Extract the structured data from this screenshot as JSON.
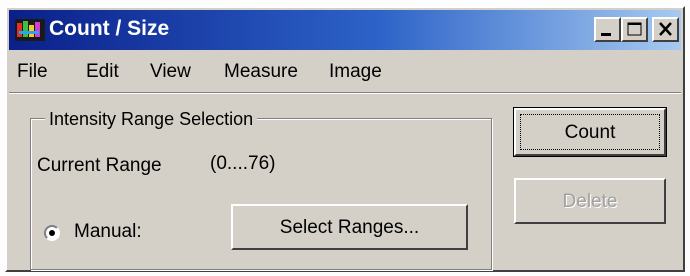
{
  "window": {
    "title": "Count / Size",
    "app_icon": "multicolor-app-icon",
    "controls": {
      "minimize_icon": "minimize-icon",
      "maximize_icon": "maximize-icon",
      "close_icon": "close-icon"
    },
    "colors": {
      "titlebar_start": "#0a1f8a",
      "titlebar_end": "#a6caf0",
      "face": "#d4d0c8"
    }
  },
  "menu": {
    "items": [
      {
        "label": "File"
      },
      {
        "label": "Edit"
      },
      {
        "label": "View"
      },
      {
        "label": "Measure"
      },
      {
        "label": "Image"
      }
    ]
  },
  "intensity": {
    "group_title": "Intensity Range Selection",
    "current_range_label": "Current Range",
    "current_range_value": "(0....76)",
    "manual_label": "Manual:",
    "manual_selected": true,
    "select_ranges_label": "Select Ranges..."
  },
  "actions": {
    "count_label": "Count",
    "delete_label": "Delete",
    "delete_enabled": false
  }
}
